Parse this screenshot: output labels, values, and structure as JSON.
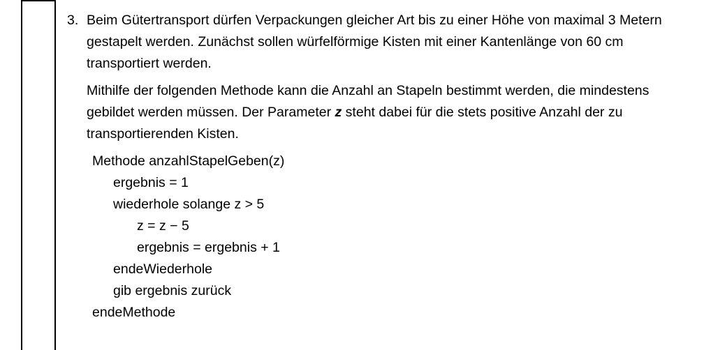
{
  "task": {
    "number": "3.",
    "paragraph1": "Beim Gütertransport dürfen Verpackungen gleicher Art bis zu einer Höhe von maximal 3 Metern gestapelt werden. Zunächst sollen würfelförmige Kisten mit einer Kantenlänge von 60 cm transportiert werden.",
    "paragraph2_before": "Mithilfe der folgenden Methode kann die Anzahl an Stapeln bestimmt werden, die mindestens gebildet werden müssen. Der Parameter ",
    "paragraph2_param": "z",
    "paragraph2_after": " steht dabei für die stets positive Anzahl der zu transportierenden Kisten."
  },
  "code": {
    "line1": "Methode anzahlStapelGeben(z)",
    "line2": "ergebnis = 1",
    "line3": "wiederhole solange z > 5",
    "line4": "z = z − 5",
    "line5": "ergebnis = ergebnis + 1",
    "line6": "endeWiederhole",
    "line7": "gib ergebnis zurück",
    "line8": "endeMethode"
  }
}
